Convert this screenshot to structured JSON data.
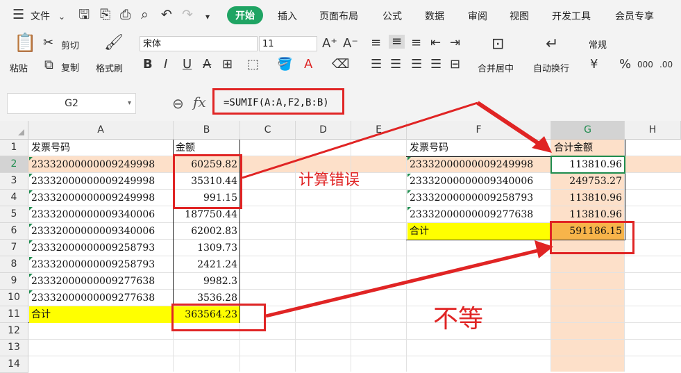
{
  "menu": {
    "file": "文件",
    "tabs": [
      "开始",
      "插入",
      "页面布局",
      "公式",
      "数据",
      "审阅",
      "视图",
      "开发工具",
      "会员专享"
    ]
  },
  "ribbon": {
    "paste": "粘贴",
    "cut": "剪切",
    "copy": "复制",
    "format_painter": "格式刷",
    "font_name": "宋体",
    "font_size": "11",
    "merge_center": "合并居中",
    "wrap_text": "自动换行",
    "number_format": "常规"
  },
  "formula_bar": {
    "name_box": "G2",
    "formula": "=SUMIF(A:A,F2,B:B)"
  },
  "columns": [
    "A",
    "B",
    "C",
    "D",
    "E",
    "F",
    "G",
    "H"
  ],
  "rows": [
    "1",
    "2",
    "3",
    "4",
    "5",
    "6",
    "7",
    "8",
    "9",
    "10",
    "11",
    "12",
    "13",
    "14"
  ],
  "left_table": {
    "header_a": "发票号码",
    "header_b": "金额",
    "rows": [
      {
        "invoice": "23332000000009249998",
        "amount": "60259.82"
      },
      {
        "invoice": "23332000000009249998",
        "amount": "35310.44"
      },
      {
        "invoice": "23332000000009249998",
        "amount": "991.15"
      },
      {
        "invoice": "23332000000009340006",
        "amount": "187750.44"
      },
      {
        "invoice": "23332000000009340006",
        "amount": "62002.83"
      },
      {
        "invoice": "23332000000009258793",
        "amount": "1309.73"
      },
      {
        "invoice": "23332000000009258793",
        "amount": "2421.24"
      },
      {
        "invoice": "23332000000009277638",
        "amount": "9982.3"
      },
      {
        "invoice": "23332000000009277638",
        "amount": "3536.28"
      }
    ],
    "total_label": "合计",
    "total_value": "363564.23"
  },
  "right_table": {
    "header_f": "发票号码",
    "header_g": "合计金额",
    "rows": [
      {
        "invoice": "23332000000009249998",
        "amount": "113810.96"
      },
      {
        "invoice": "23332000000009340006",
        "amount": "249753.27"
      },
      {
        "invoice": "23332000000009258793",
        "amount": "113810.96"
      },
      {
        "invoice": "23332000000009277638",
        "amount": "113810.96"
      }
    ],
    "total_label": "合计",
    "total_value": "591186.15"
  },
  "annotations": {
    "calc_error": "计算错误",
    "not_equal": "不等"
  },
  "colors": {
    "accent_green": "#1fa463",
    "annotation_red": "#e02424",
    "total_fill": "#ffff00",
    "total_fill_orange": "#f7b44a",
    "selection_row": "#fde0c9"
  }
}
